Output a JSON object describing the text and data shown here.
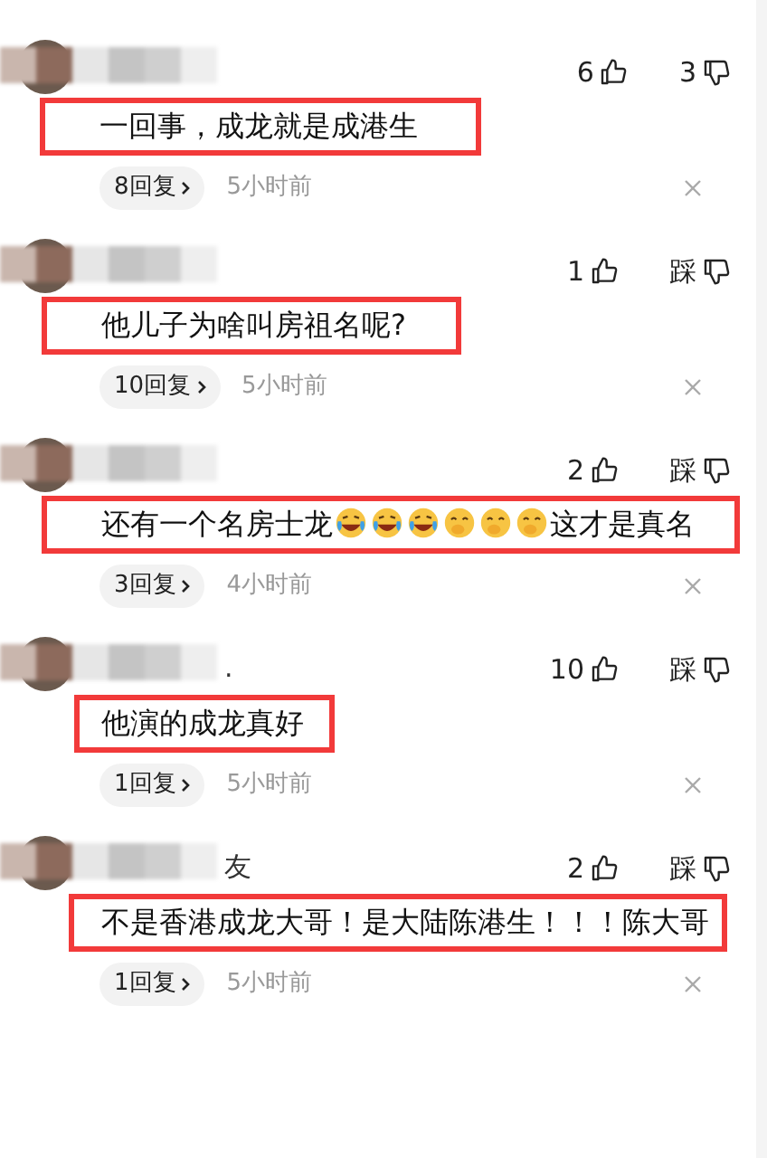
{
  "comments": [
    {
      "likes": "6",
      "dislike": "3",
      "text": [
        {
          "kind": "text",
          "value": "一回事，成龙就是成港生"
        }
      ],
      "replies": "8回复",
      "time": "5小时前"
    },
    {
      "likes": "1",
      "dislike": "踩",
      "text": [
        {
          "kind": "text",
          "value": "他儿子为啥叫房祖名呢?"
        }
      ],
      "replies": "10回复",
      "time": "5小时前"
    },
    {
      "likes": "2",
      "dislike": "踩",
      "text": [
        {
          "kind": "text",
          "value": "还有一个名房士龙"
        },
        {
          "kind": "crylaugh"
        },
        {
          "kind": "crylaugh"
        },
        {
          "kind": "crylaugh"
        },
        {
          "kind": "giggle"
        },
        {
          "kind": "giggle"
        },
        {
          "kind": "giggle"
        },
        {
          "kind": "text",
          "value": "这才是真名"
        }
      ],
      "replies": "3回复",
      "time": "4小时前"
    },
    {
      "name_fragment": ".",
      "likes": "10",
      "dislike": "踩",
      "text": [
        {
          "kind": "text",
          "value": "他演的成龙真好"
        }
      ],
      "replies": "1回复",
      "time": "5小时前"
    },
    {
      "name_fragment": "友",
      "likes": "2",
      "dislike": "踩",
      "text": [
        {
          "kind": "text",
          "value": "不是香港成龙大哥！是大陆陈港生！！！陈大哥"
        }
      ],
      "replies": "1回复",
      "time": "5小时前"
    }
  ]
}
